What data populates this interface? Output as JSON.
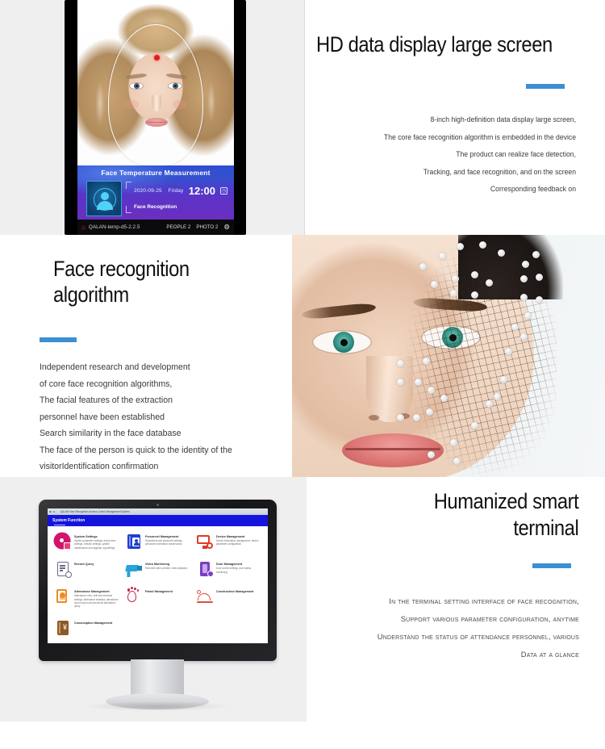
{
  "sections": [
    {
      "id": "hd-screen",
      "title": "HD data display large screen",
      "body_lines": [
        "8-inch high-definition data display large screen,",
        "The core face recognition algorithm is embedded in the device",
        "The product can realize face detection,",
        "Tracking, and face recognition, and on the screen",
        "Corresponding feedback on"
      ]
    },
    {
      "id": "face-algorithm",
      "title": "Face recognition algorithm",
      "body_lines": [
        "Independent research and development",
        "of core face recognition algorithms,",
        "The facial features of the extraction",
        " personnel have been established",
        "Search similarity in the face database",
        "The face of the person is quick to the identity of the",
        "visitorIdentification confirmation"
      ]
    },
    {
      "id": "smart-terminal",
      "title": "Humanized smart terminal",
      "body_lines": [
        "In the terminal setting interface of face recognition,",
        "Support various parameter configuration, anytime",
        "Understand the status of attendance personnel, various",
        "Data at a glance"
      ]
    }
  ],
  "device_screen": {
    "panel_title": "Face Temperature Measurement",
    "date": "2020-09-25",
    "weekday": "Friday",
    "time": "12:00",
    "mode_label": "Face Recognition",
    "status_bar": {
      "version": "QALAN-temp-d5-2.2.5",
      "people_label": "PEOPLE 2",
      "photo_label": "PHOTO 2"
    }
  },
  "dashboard": {
    "window_title": "QALAN Face Recognition Access Control Management System",
    "header_title": "System Function",
    "items": [
      {
        "name": "System Settings",
        "desc": "System parameter settings, device time settings, network settings, system maintenance and upgrade, log settings"
      },
      {
        "name": "Personnel Management",
        "desc": "Department and personnel settings, personnel information maintenance"
      },
      {
        "name": "Device Management",
        "desc": "Device information management, device parameter configuration"
      },
      {
        "name": "Record Query",
        "desc": ""
      },
      {
        "name": "Video Monitoring",
        "desc": "Real-time video preview, video playback"
      },
      {
        "name": "Door Management",
        "desc": "Door control settings, door status monitoring"
      },
      {
        "name": "Attendance Management",
        "desc": "Attendance rules, shift and schedule settings, attendance statistics, attendance report export and personnel attendance query"
      },
      {
        "name": "Patrol Management",
        "desc": ""
      },
      {
        "name": "Construction Management",
        "desc": ""
      },
      {
        "name": "Consumption Management",
        "desc": ""
      }
    ]
  },
  "colors": {
    "accent": "#3d8fd4",
    "panel_gray": "#efeff0",
    "headline": "#111111",
    "body_text": "#3b3b3b",
    "temp_dot": "#e8191b",
    "dash_titlebar": "#1414dd"
  }
}
